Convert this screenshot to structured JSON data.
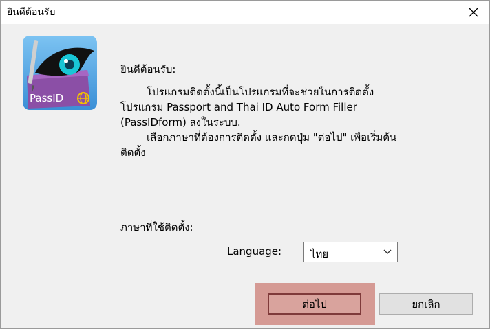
{
  "window": {
    "title": "ยินดีต้อนรับ"
  },
  "icon": {
    "name": "passid-app-icon",
    "badge_text": "PassID",
    "colors": {
      "bg": "#4fa6e6",
      "book": "#8b4fa6",
      "eye": "#1a1a1a",
      "iris": "#19c6d6"
    }
  },
  "content": {
    "heading": "ยินดีต้อนรับ:",
    "lines": [
      "โปรแกรมติดตั้งนี้เป็นโปรแกรมที่จะช่วยในการติดตั้ง",
      "โปรแกรม Passport and Thai ID Auto Form Filler",
      "(PassIDform) ลงในระบบ.",
      "เลือกภาษาที่ต้องการติดตั้ง และกดปุ่ม \"ต่อไป\" เพื่อเริ่มต้น",
      "ติดตั้ง"
    ],
    "language_prompt": "ภาษาที่ใช้ติดตั้ง:",
    "language_label": "Language:",
    "language_value": "ไทย"
  },
  "buttons": {
    "next_label": "ต่อไป",
    "cancel_label": "ยกเลิก"
  }
}
